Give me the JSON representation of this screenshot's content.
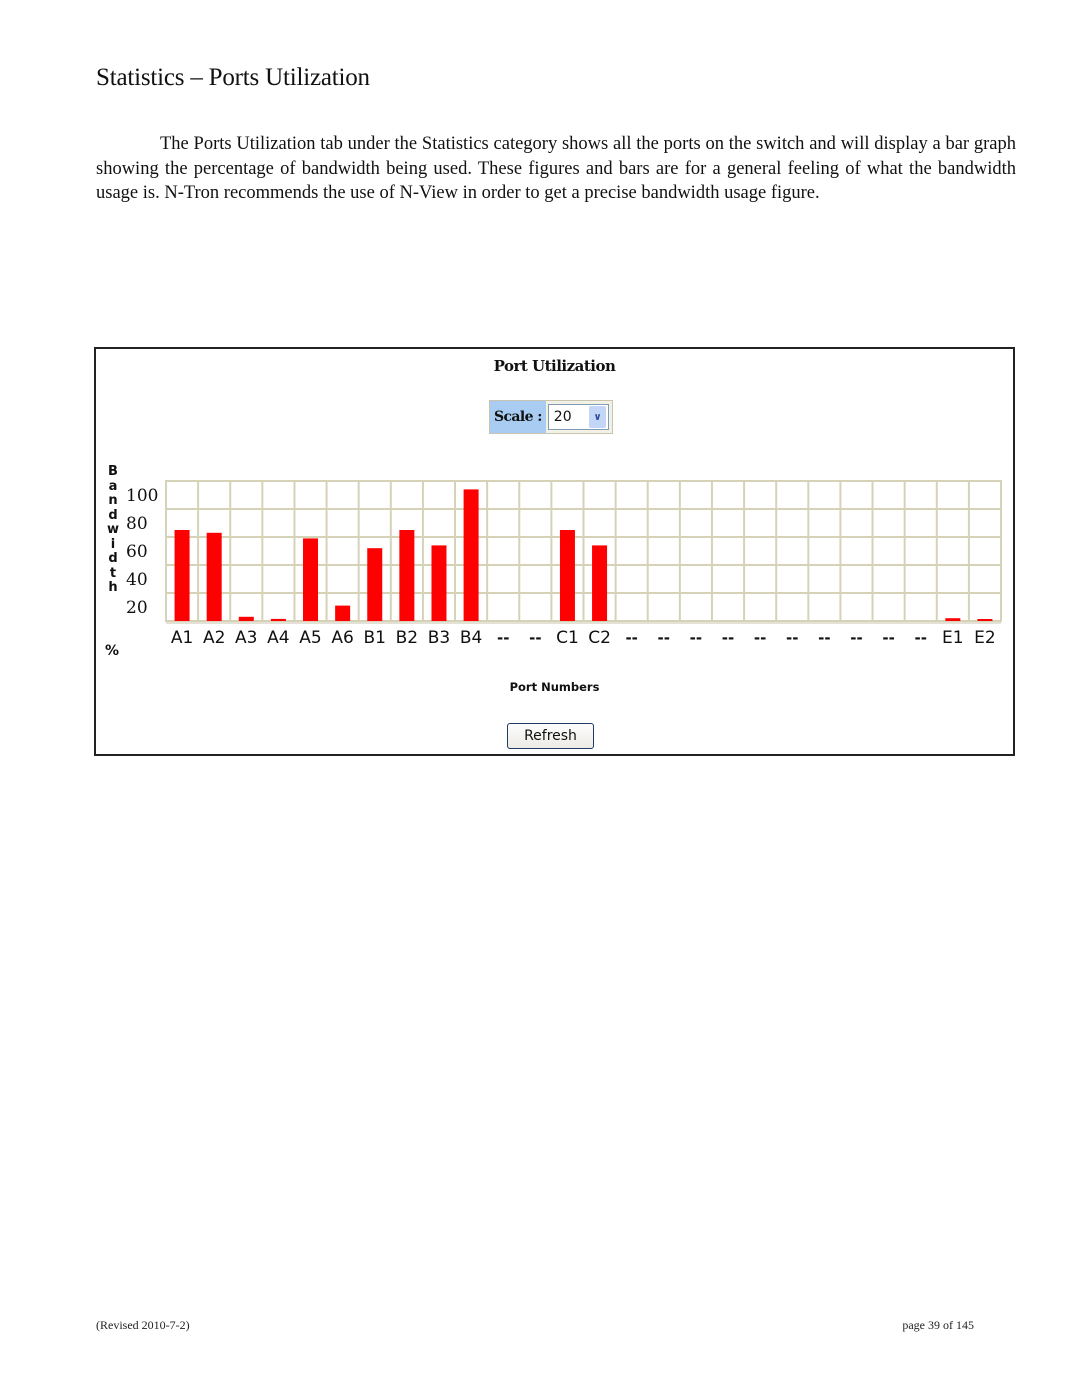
{
  "page": {
    "title": "Statistics – Ports Utilization",
    "paragraph": "The Ports Utilization tab under the Statistics category shows all the ports on the switch and will display a bar graph showing the percentage of bandwidth being used. These figures and bars are for a general feeling of what the bandwidth usage is.  N-Tron recommends the use of N-View in order to get a precise bandwidth usage figure.",
    "footer_left": "(Revised 2010-7-2)",
    "footer_right": "page 39 of 145"
  },
  "panel": {
    "title": "Port Utilization",
    "scale_label": "Scale :",
    "scale_value": "20",
    "scale_arrow_icon": "chevron-down-icon",
    "refresh_label": "Refresh"
  },
  "chart_data": {
    "type": "bar",
    "title": "Port Utilization",
    "xlabel": "Port Numbers",
    "ylabel": "Bandwidth %",
    "ylabel_letters": [
      "B",
      "a",
      "n",
      "d",
      "w",
      "i",
      "d",
      "t",
      "h"
    ],
    "ylabel_unit": "%",
    "ylim": [
      0,
      100
    ],
    "yticks": [
      "100",
      "80",
      "60",
      "40",
      "20"
    ],
    "grid": true,
    "bar_color": "#ff0000",
    "grid_color": "#d6d2b8",
    "categories": [
      "A1",
      "A2",
      "A3",
      "A4",
      "A5",
      "A6",
      "B1",
      "B2",
      "B3",
      "B4",
      "--",
      "--",
      "C1",
      "C2",
      "--",
      "--",
      "--",
      "--",
      "--",
      "--",
      "--",
      "--",
      "--",
      "--",
      "E1",
      "E2"
    ],
    "values": [
      65,
      63,
      3,
      1.5,
      59,
      11,
      52,
      65,
      54,
      94,
      0,
      0,
      65,
      54,
      0,
      0,
      0,
      0,
      0,
      0,
      0,
      0,
      0,
      0,
      2,
      1
    ]
  }
}
